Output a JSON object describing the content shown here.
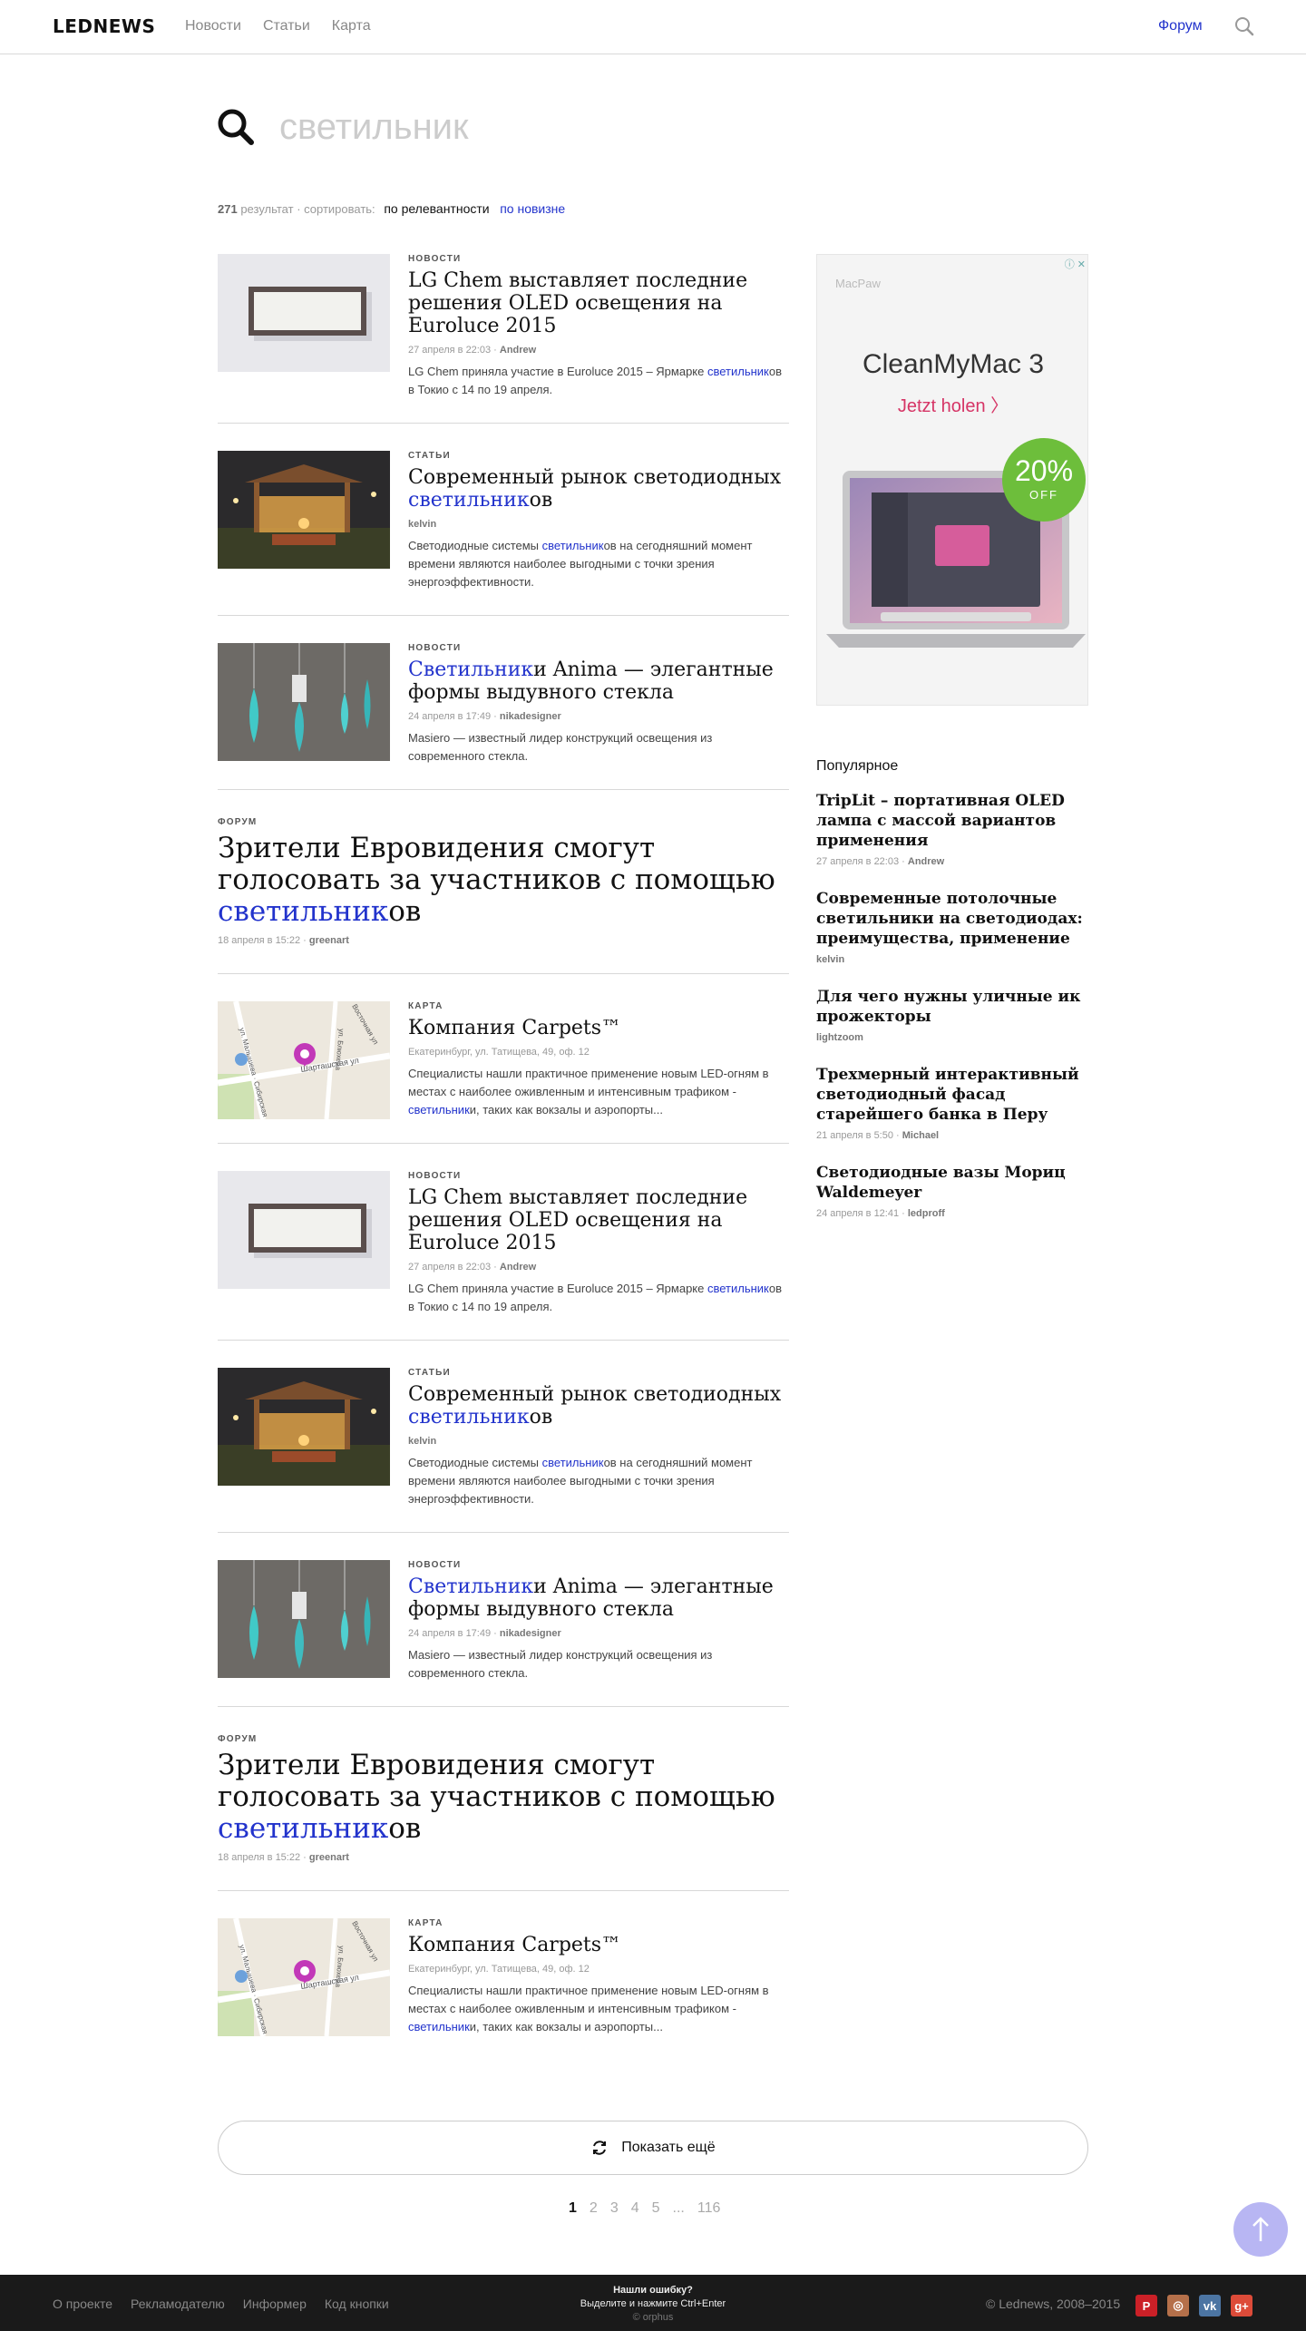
{
  "header": {
    "logo": "LEDNEWS",
    "nav": [
      "Новости",
      "Статьи",
      "Карта"
    ],
    "forum": "Форум"
  },
  "search": {
    "value": "светильник",
    "placeholder": "светильник"
  },
  "results_meta": {
    "count": "271",
    "count_suffix": "результат · сортировать:",
    "sort_relevance": "по релевантности",
    "sort_newest": "по новизне"
  },
  "results": [
    {
      "category": "Новости",
      "title_pre": "LG Chem выставляет последние решения OLED освещения на Euroluce 2015",
      "title_hl": "",
      "title_post": "",
      "date": "27 апреля в 22:03",
      "author": "Andrew",
      "ex_pre": "LG Chem приняла участие в Euroluce 2015 – Ярмарке ",
      "ex_hl": "светильник",
      "ex_post": "ов в Токио с 14 по 19 апреля.",
      "thumb": "panel"
    },
    {
      "category": "Статьи",
      "title_pre": "Современный рынок светодиодных ",
      "title_hl": "светильник",
      "title_post": "ов",
      "date": "",
      "author": "kelvin",
      "ex_pre": "Светодиодные системы ",
      "ex_hl": "светильник",
      "ex_post": "ов на сегодняшний момент времени являются наиболее выгодными с точки зрения энергоэффективности.",
      "thumb": "gazebo"
    },
    {
      "category": "Новости",
      "title_pre": "",
      "title_hl": "Светильник",
      "title_post": "и Anima — элегантные формы выдувного стекла",
      "date": "24 апреля в 17:49",
      "author": "nikadesigner",
      "ex_pre": "Masiero — известный лидер конструкций освещения из современного стекла.",
      "ex_hl": "",
      "ex_post": "",
      "thumb": "glass"
    },
    {
      "category": "Форум",
      "title_pre": "Зрители Евровидения смогут голосовать за участников с помощью ",
      "title_hl": "светильник",
      "title_post": "ов",
      "date": "18 апреля в 15:22",
      "author": "greenart",
      "ex_pre": "",
      "ex_hl": "",
      "ex_post": "",
      "thumb": "none"
    },
    {
      "category": "Карта",
      "title_pre": "Компания Carpets™",
      "title_hl": "",
      "title_post": "",
      "date": "Екатеринбург, ул. Татищева, 49, оф. 12",
      "author": "",
      "ex_pre": "Специалисты нашли практичное применение новым LED-огням в местах с наиболее оживленным и интенсивным трафиком - ",
      "ex_hl": "светильник",
      "ex_post": "и, таких как вокзалы и аэропорты...",
      "thumb": "map"
    },
    {
      "category": "Новости",
      "title_pre": "LG Chem выставляет последние решения OLED освещения на Euroluce 2015",
      "title_hl": "",
      "title_post": "",
      "date": "27 апреля в 22:03",
      "author": "Andrew",
      "ex_pre": "LG Chem приняла участие в Euroluce 2015 – Ярмарке ",
      "ex_hl": "светильник",
      "ex_post": "ов в Токио с 14 по 19 апреля.",
      "thumb": "panel"
    },
    {
      "category": "Статьи",
      "title_pre": "Современный рынок светодиодных ",
      "title_hl": "светильник",
      "title_post": "ов",
      "date": "",
      "author": "kelvin",
      "ex_pre": "Светодиодные системы ",
      "ex_hl": "светильник",
      "ex_post": "ов на сегодняшний момент времени являются наиболее выгодными с точки зрения энергоэффективности.",
      "thumb": "gazebo"
    },
    {
      "category": "Новости",
      "title_pre": "",
      "title_hl": "Светильник",
      "title_post": "и Anima — элегантные формы выдувного стекла",
      "date": "24 апреля в 17:49",
      "author": "nikadesigner",
      "ex_pre": "Masiero — известный лидер конструкций освещения из современного стекла.",
      "ex_hl": "",
      "ex_post": "",
      "thumb": "glass"
    },
    {
      "category": "Форум",
      "title_pre": "Зрители Евровидения смогут голосовать за участников с помощью ",
      "title_hl": "светильник",
      "title_post": "ов",
      "date": "18 апреля в 15:22",
      "author": "greenart",
      "ex_pre": "",
      "ex_hl": "",
      "ex_post": "",
      "thumb": "none"
    },
    {
      "category": "Карта",
      "title_pre": "Компания Carpets™",
      "title_hl": "",
      "title_post": "",
      "date": "Екатеринбург, ул. Татищева, 49, оф. 12",
      "author": "",
      "ex_pre": "Специалисты нашли практичное применение новым LED-огням в местах с наиболее оживленным и интенсивным трафиком - ",
      "ex_hl": "светильник",
      "ex_post": "и, таких как вокзалы и аэропорты...",
      "thumb": "map"
    }
  ],
  "map_labels": {
    "street1": "ул. Малышева · Сибирская",
    "street2": "ул. Блюхера",
    "street3": "Шарташская ул",
    "street4": "Восточная ул"
  },
  "ad": {
    "brand": "MacPaw",
    "title": "CleanMyMac 3",
    "cta": "Jetzt holen  〉",
    "badge_pct": "20%",
    "badge_off": "OFF",
    "close": "ⓘ ✕"
  },
  "popular": {
    "heading": "Популярное",
    "items": [
      {
        "title": "TripLit – портативная OLED лампа с массой вариантов применения",
        "date": "27 апреля в 22:03",
        "author": "Andrew"
      },
      {
        "title": "Современные потолочные светильники на светодиодах: преимущества, применение",
        "date": "",
        "author": "kelvin"
      },
      {
        "title": "Для чего нужны уличные ик прожекторы",
        "date": "",
        "author": "lightzoom"
      },
      {
        "title": "Трехмерный интерактивный светодиодный фасад старейшего банка в Перу",
        "date": "21 апреля в 5:50",
        "author": "Michael"
      },
      {
        "title": "Светодиодные вазы Мориц Waldemeyer",
        "date": "24 апреля в 12:41",
        "author": "ledproff"
      }
    ]
  },
  "load_more": "Показать ещё",
  "pager": [
    "1",
    "2",
    "3",
    "4",
    "5",
    "...",
    "116"
  ],
  "footer": {
    "links": [
      "О проекте",
      "Рекламодателю",
      "Информер",
      "Код кнопки"
    ],
    "bug_title": "Нашли ошибку?",
    "bug_hint": "Выделите и нажмите Ctrl+Enter",
    "orphus": "© orphus",
    "copyright": "© Lednews, 2008–2015",
    "socials": [
      {
        "name": "pinterest",
        "glyph": "P",
        "color": "#cb2027"
      },
      {
        "name": "instagram",
        "glyph": "◎",
        "color": "#b5704a"
      },
      {
        "name": "vk",
        "glyph": "vk",
        "color": "#4c75a3"
      },
      {
        "name": "google-plus",
        "glyph": "g+",
        "color": "#dd4b39"
      }
    ]
  }
}
